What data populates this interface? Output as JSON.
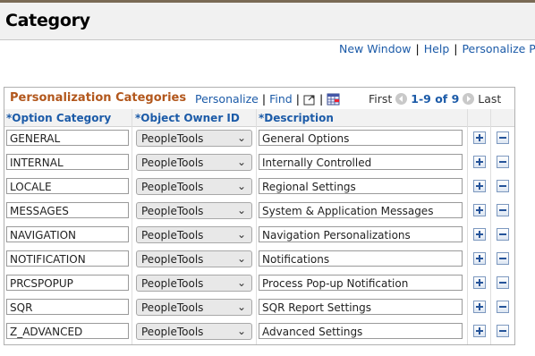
{
  "page": {
    "title": "Category"
  },
  "toplinks": {
    "new_window": "New Window",
    "help": "Help",
    "personalize_page": "Personalize Page",
    "separator": "|"
  },
  "grid": {
    "title": "Personalization Categories",
    "personalize": "Personalize",
    "find": "Find",
    "view_all_icon": "zoom-window-icon",
    "download_icon": "spreadsheet-icon",
    "first": "First",
    "count": "1-9 of 9",
    "last": "Last",
    "columns": {
      "option_category": "*Option Category",
      "object_owner": "*Object Owner ID",
      "description": "*Description"
    },
    "rows": [
      {
        "category": "GENERAL",
        "owner": "PeopleTools",
        "description": "General Options"
      },
      {
        "category": "INTERNAL",
        "owner": "PeopleTools",
        "description": "Internally Controlled"
      },
      {
        "category": "LOCALE",
        "owner": "PeopleTools",
        "description": "Regional Settings"
      },
      {
        "category": "MESSAGES",
        "owner": "PeopleTools",
        "description": "System & Application Messages"
      },
      {
        "category": "NAVIGATION",
        "owner": "PeopleTools",
        "description": "Navigation Personalizations"
      },
      {
        "category": "NOTIFICATION",
        "owner": "PeopleTools",
        "description": "Notifications"
      },
      {
        "category": "PRCSPOPUP",
        "owner": "PeopleTools",
        "description": "Process Pop-up Notification"
      },
      {
        "category": "SQR",
        "owner": "PeopleTools",
        "description": "SQR Report Settings"
      },
      {
        "category": "Z_ADVANCED",
        "owner": "PeopleTools",
        "description": "Advanced Settings"
      }
    ]
  },
  "colors": {
    "title_orange": "#b2571c",
    "link_blue": "#1c5ba8"
  }
}
